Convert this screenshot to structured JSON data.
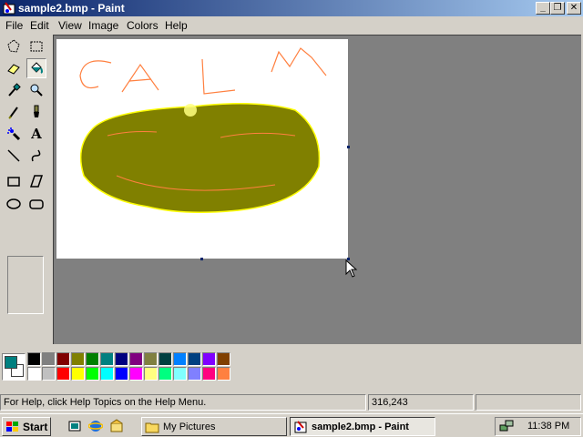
{
  "window": {
    "title": "sample2.bmp - Paint",
    "controls": {
      "minimize": "_",
      "restore": "❐",
      "close": "✕"
    }
  },
  "menu": [
    "File",
    "Edit",
    "View",
    "Image",
    "Colors",
    "Help"
  ],
  "tools": [
    {
      "name": "free-form-select-icon",
      "selected": false
    },
    {
      "name": "rect-select-icon",
      "selected": false
    },
    {
      "name": "eraser-icon",
      "selected": false
    },
    {
      "name": "fill-icon",
      "selected": true
    },
    {
      "name": "pick-color-icon",
      "selected": false
    },
    {
      "name": "magnifier-icon",
      "selected": false
    },
    {
      "name": "pencil-icon",
      "selected": false
    },
    {
      "name": "brush-icon",
      "selected": false
    },
    {
      "name": "airbrush-icon",
      "selected": false
    },
    {
      "name": "text-icon",
      "selected": false
    },
    {
      "name": "line-icon",
      "selected": false
    },
    {
      "name": "curve-icon",
      "selected": false
    },
    {
      "name": "rectangle-icon",
      "selected": false
    },
    {
      "name": "polygon-icon",
      "selected": false
    },
    {
      "name": "ellipse-icon",
      "selected": false
    },
    {
      "name": "rounded-rect-icon",
      "selected": false
    }
  ],
  "text_tool_glyph": "A",
  "canvas": {
    "drawn_text": "CALM",
    "blob_color": "#808000",
    "outline_color": "#ffff00",
    "stroke_color": "#ff8040"
  },
  "colors": {
    "foreground": "#008080",
    "background": "#ffffff",
    "row1": [
      "#000000",
      "#808080",
      "#800000",
      "#808000",
      "#008000",
      "#008080",
      "#000080",
      "#800080",
      "#808040",
      "#004040",
      "#0080ff",
      "#004080",
      "#8000ff",
      "#804000"
    ],
    "row2": [
      "#ffffff",
      "#c0c0c0",
      "#ff0000",
      "#ffff00",
      "#00ff00",
      "#00ffff",
      "#0000ff",
      "#ff00ff",
      "#ffff80",
      "#00ff80",
      "#80ffff",
      "#8080ff",
      "#ff0080",
      "#ff8040"
    ]
  },
  "status": {
    "help": "For Help, click Help Topics on the Help Menu.",
    "coords": "316,243",
    "size": ""
  },
  "taskbar": {
    "start": "Start",
    "buttons": [
      {
        "label": "My Pictures",
        "active": false
      },
      {
        "label": "sample2.bmp - Paint",
        "active": true
      }
    ],
    "clock": "11:38 PM"
  }
}
